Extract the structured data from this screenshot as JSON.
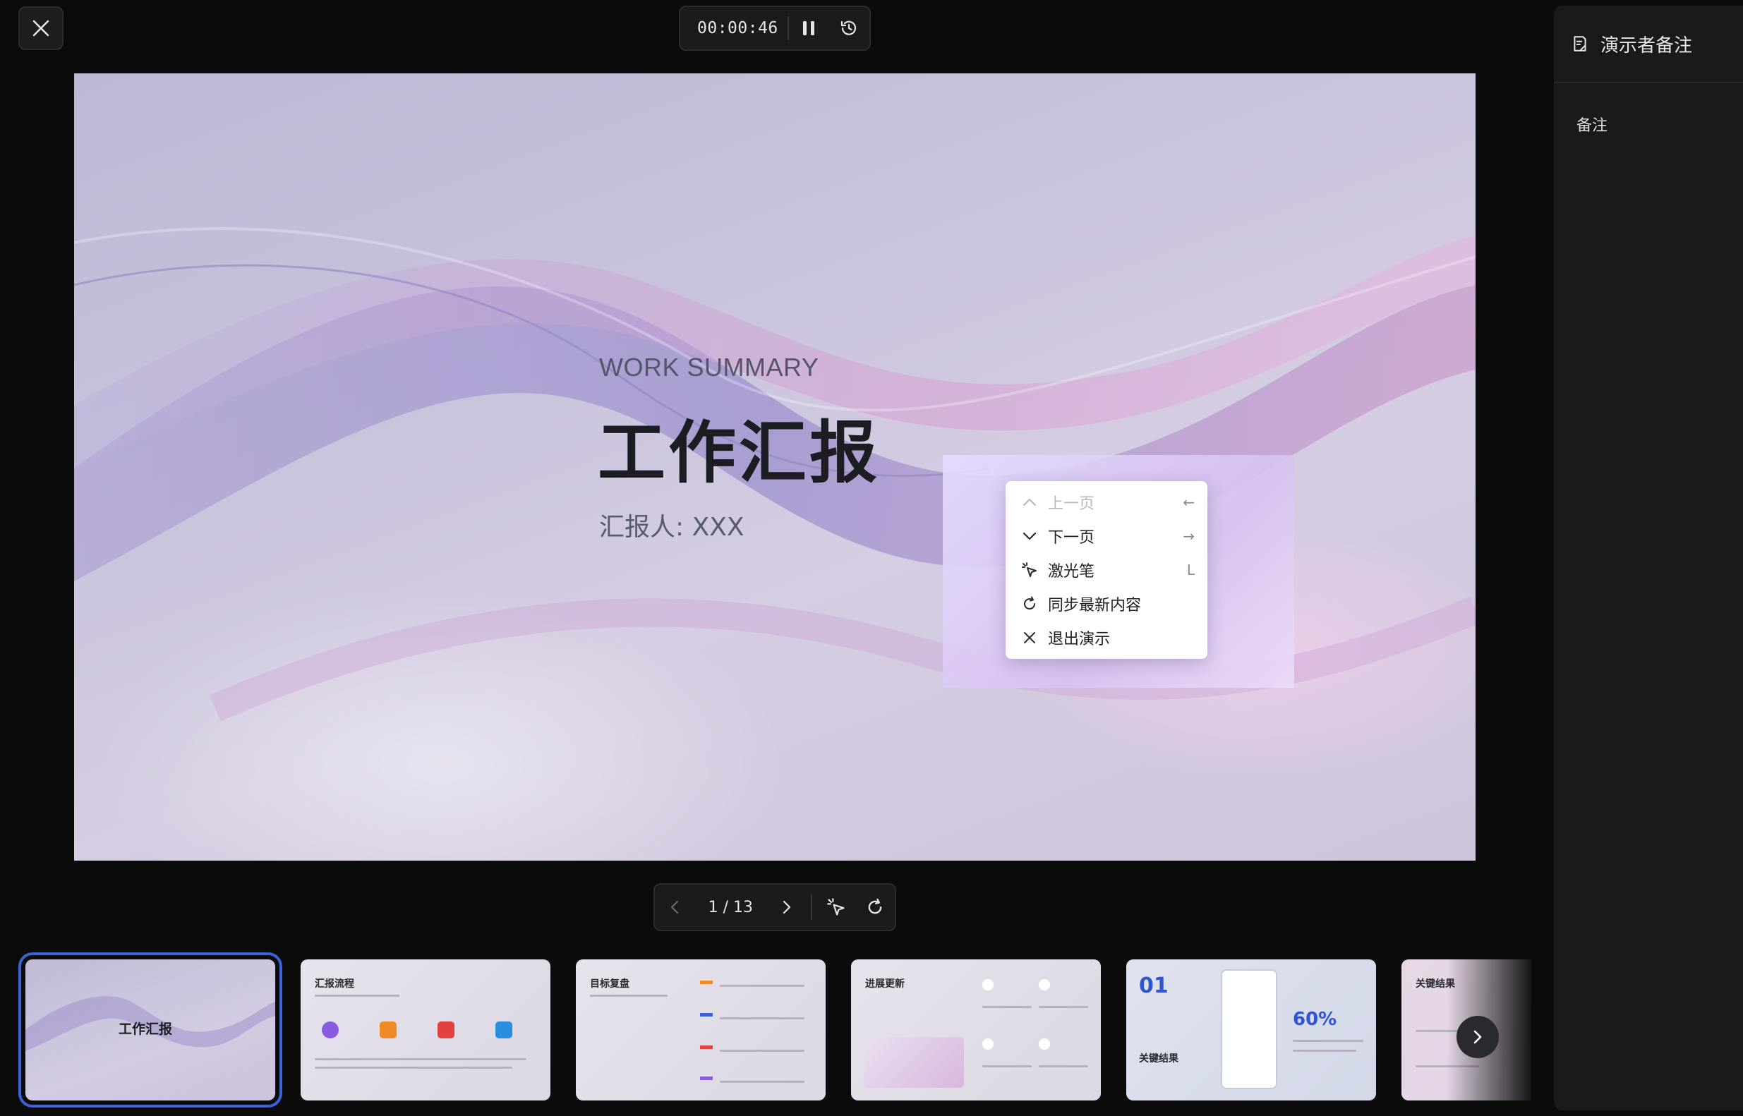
{
  "timer": {
    "elapsed": "00:00:46"
  },
  "slide": {
    "subtitle": "WORK SUMMARY",
    "title": "工作汇报",
    "presenter": "汇报人: XXX"
  },
  "context_menu": {
    "items": [
      {
        "label": "上一页",
        "shortcut": "←",
        "icon": "chevron-up-icon",
        "enabled": false
      },
      {
        "label": "下一页",
        "shortcut": "→",
        "icon": "chevron-down-icon",
        "enabled": true
      },
      {
        "label": "激光笔",
        "shortcut": "L",
        "icon": "laser-pointer-icon",
        "enabled": true
      },
      {
        "label": "同步最新内容",
        "shortcut": "",
        "icon": "refresh-icon",
        "enabled": true
      },
      {
        "label": "退出演示",
        "shortcut": "",
        "icon": "close-icon",
        "enabled": true
      }
    ]
  },
  "navbar": {
    "page_indicator": "1 / 13"
  },
  "thumbnails": [
    {
      "title": "工作汇报",
      "active": true
    },
    {
      "title": "汇报流程",
      "active": false
    },
    {
      "title": "目标复盘",
      "active": false
    },
    {
      "title": "进展更新",
      "active": false
    },
    {
      "title": "关键结果",
      "number": "01",
      "stat": "60%",
      "active": false
    },
    {
      "title": "关键结果",
      "active": false
    }
  ],
  "notes": {
    "header": "演示者备注",
    "placeholder": "备注"
  },
  "colors": {
    "accent": "#3a63d8",
    "background": "#0b0b0c",
    "panel": "#1a1a1c"
  }
}
